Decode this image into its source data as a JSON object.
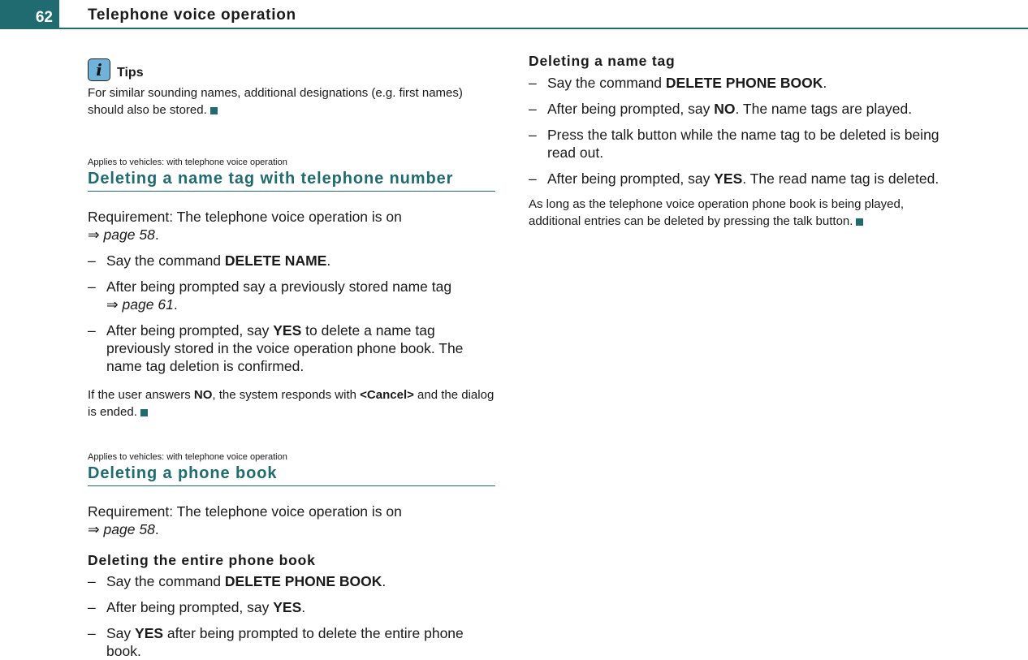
{
  "header": {
    "page_number": "62",
    "title": "Telephone voice operation"
  },
  "tips": {
    "icon": "info-icon",
    "label": "Tips",
    "text": "For similar sounding names, additional designations (e.g. first names) should also be stored."
  },
  "section1": {
    "applies": "Applies to vehicles: with telephone voice operation",
    "title": "Deleting a name tag with telephone number",
    "requirement_text": "Requirement: The telephone voice operation is on",
    "requirement_arrow": "⇒",
    "requirement_ref": "page 58",
    "steps": [
      {
        "pre": "Say the command ",
        "bold": "DELETE NAME",
        "post": "."
      },
      {
        "pre": "After being prompted say a previously stored name tag",
        "arrow": "⇒",
        "ref": "page 61",
        "post": "."
      },
      {
        "pre": "After being prompted, say ",
        "bold": "YES",
        "post": " to delete a name tag previously stored in the voice operation phone book. The name tag deletion is confirmed."
      }
    ],
    "note": {
      "pre": "If the user answers ",
      "bold1": "NO",
      "mid": ", the system responds with ",
      "bold2": "<Cancel>",
      "post": " and the dialog is ended."
    }
  },
  "section2": {
    "applies": "Applies to vehicles: with telephone voice operation",
    "title": "Deleting a phone book",
    "requirement_text": "Requirement: The telephone voice operation is on",
    "requirement_arrow": "⇒",
    "requirement_ref": "page 58",
    "sub1": {
      "title": "Deleting the entire phone book",
      "steps": [
        {
          "pre": "Say the command ",
          "bold": "DELETE PHONE BOOK",
          "post": "."
        },
        {
          "pre": "After being prompted, say ",
          "bold": "YES",
          "post": "."
        },
        {
          "pre": "Say ",
          "bold": "YES",
          "post": " after being prompted to delete the entire phone book."
        }
      ]
    },
    "sub2": {
      "title": "Deleting a name tag",
      "steps": [
        {
          "pre": "Say the command ",
          "bold": "DELETE PHONE BOOK",
          "post": "."
        },
        {
          "pre": "After being prompted, say ",
          "bold": "NO",
          "post": ". The name tags are played."
        },
        {
          "pre": "Press the talk button while the name tag to be deleted is being read out.",
          "bold": "",
          "post": ""
        },
        {
          "pre": "After being prompted, say ",
          "bold": "YES",
          "post": ". The read name tag is deleted."
        }
      ],
      "note": "As long as the telephone voice operation phone book is being played, additional entries can be deleted by pressing the talk button."
    }
  },
  "dash": "–"
}
